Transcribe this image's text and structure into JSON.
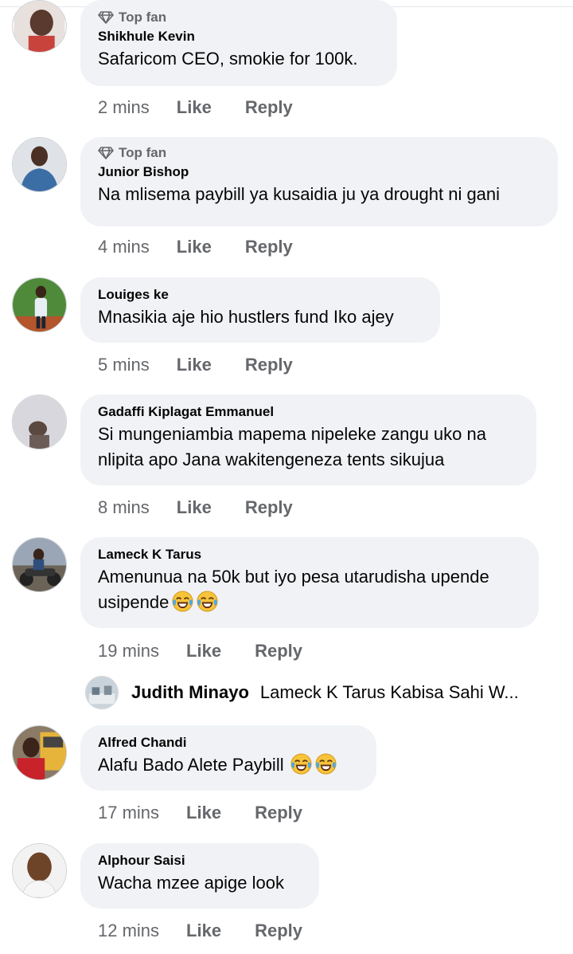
{
  "badge_label": "Top fan",
  "action_like": "Like",
  "action_reply": "Reply",
  "comments": [
    {
      "name": "Shikhule Kevin",
      "text": "Safaricom CEO, smokie for 100k.",
      "time": "2 mins",
      "top_fan": true
    },
    {
      "name": "Junior Bishop",
      "text": "Na mlisema paybill ya kusaidia ju ya drought  ni gani",
      "time": "4 mins",
      "top_fan": true
    },
    {
      "name": "Louiges ke",
      "text": "Mnasikia aje hio hustlers fund Iko ajey",
      "time": "5 mins",
      "top_fan": false
    },
    {
      "name": "Gadaffi Kiplagat Emmanuel",
      "text_line1": "Si mungeniambia mapema nipeleke zangu uko na",
      "text_line2": "nlipita apo Jana wakitengeneza tents sikujua",
      "time": "8 mins",
      "top_fan": false
    },
    {
      "name": "Lameck K Tarus",
      "text_line1": "Amenunua na 50k but iyo pesa utarudisha upende",
      "text_line2": "usipende",
      "emoji": "face-with-tears-of-joy",
      "time": "19 mins",
      "top_fan": false
    },
    {
      "name": "Alfred Chandi",
      "text": "Alafu Bado Alete Paybill",
      "emoji": "face-with-tears-of-joy",
      "time": "17 mins",
      "top_fan": false
    },
    {
      "name": "Alphour Saisi",
      "text": "Wacha mzee apige look",
      "time": "12 mins",
      "top_fan": false
    }
  ],
  "reply": {
    "name": "Judith Minayo",
    "text": "Lameck K Tarus Kabisa Sahi W..."
  }
}
